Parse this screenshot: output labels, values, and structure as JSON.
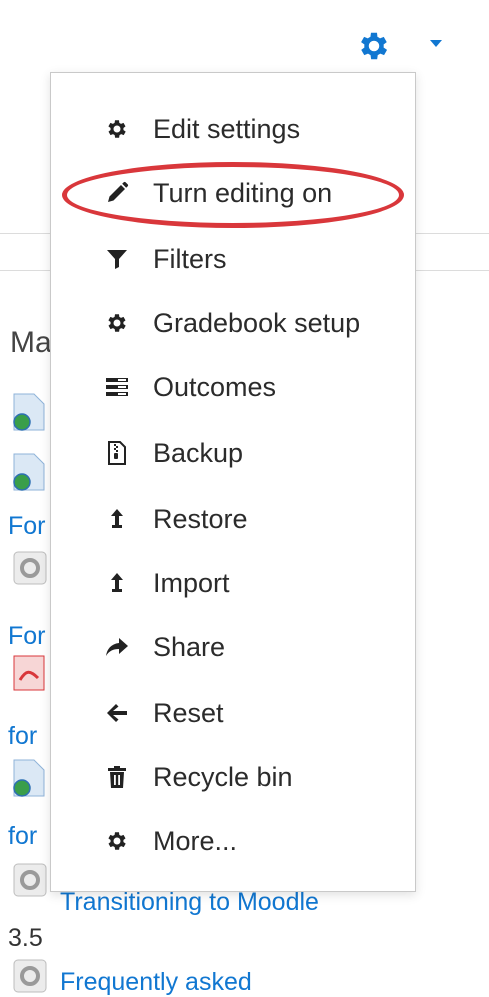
{
  "header": {
    "gear_icon": "gear-icon",
    "caret_icon": "caret-down-icon",
    "accent_color": "#1177d1"
  },
  "background": {
    "section_title": "Ma",
    "links": [
      {
        "text": "For"
      },
      {
        "text": "For"
      },
      {
        "text": "for"
      },
      {
        "text": "for"
      },
      {
        "text": "Transitioning to Moodle"
      },
      {
        "text": "3.5"
      },
      {
        "text": "Frequently asked"
      }
    ]
  },
  "menu": {
    "items": [
      {
        "label": "Edit settings",
        "icon": "gear-icon"
      },
      {
        "label": "Turn editing on",
        "icon": "pencil-icon"
      },
      {
        "label": "Filters",
        "icon": "filter-icon"
      },
      {
        "label": "Gradebook setup",
        "icon": "gear-icon"
      },
      {
        "label": "Outcomes",
        "icon": "list-icon"
      },
      {
        "label": "Backup",
        "icon": "file-archive-icon"
      },
      {
        "label": "Restore",
        "icon": "level-up-icon"
      },
      {
        "label": "Import",
        "icon": "level-up-icon"
      },
      {
        "label": "Share",
        "icon": "share-icon"
      },
      {
        "label": "Reset",
        "icon": "arrow-left-icon"
      },
      {
        "label": "Recycle bin",
        "icon": "trash-icon"
      },
      {
        "label": "More...",
        "icon": "gear-icon"
      }
    ],
    "highlighted_item": "Turn editing on",
    "highlight_color": "#d9373b"
  }
}
